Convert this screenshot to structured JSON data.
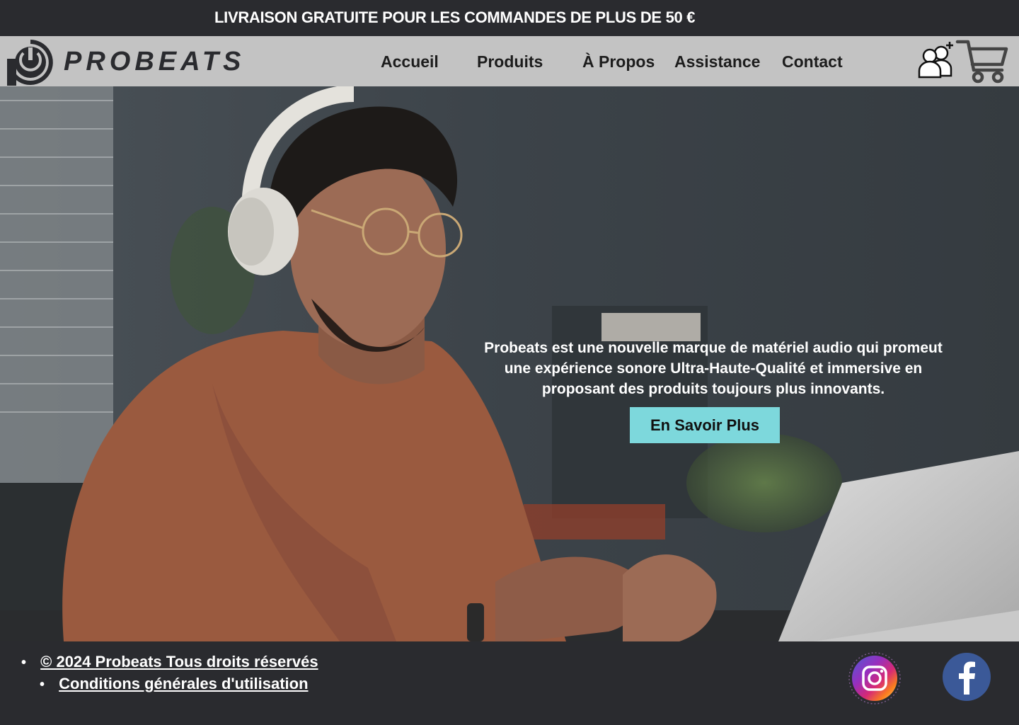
{
  "promo": {
    "text": "LIVRAISON GRATUITE POUR LES COMMANDES DE PLUS DE 50 €"
  },
  "brand": {
    "name": "PROBEATS"
  },
  "nav": {
    "items": [
      {
        "label": "Accueil"
      },
      {
        "label": "Produits"
      },
      {
        "label": "À Propos"
      },
      {
        "label": "Assistance"
      },
      {
        "label": "Contact"
      }
    ]
  },
  "header_icons": [
    "account-icon",
    "cart-icon"
  ],
  "hero": {
    "lines": [
      "Probeats est une nouvelle marque de matériel audio qui promeut",
      "une expérience  sonore Ultra-Haute-Qualité et immersive en",
      "proposant des produits toujours plus innovants."
    ],
    "button": "En Savoir Plus"
  },
  "footer": {
    "copyright": "© 2024  Probeats Tous droits réservés",
    "terms": "Conditions générales d'utilisation"
  },
  "social": [
    "instagram-icon",
    "facebook-icon"
  ],
  "colors": {
    "dark": "#2a2b2f",
    "header": "#c3c3c3",
    "accent": "#7dd8dc",
    "shirt": "#9a5a3f"
  }
}
